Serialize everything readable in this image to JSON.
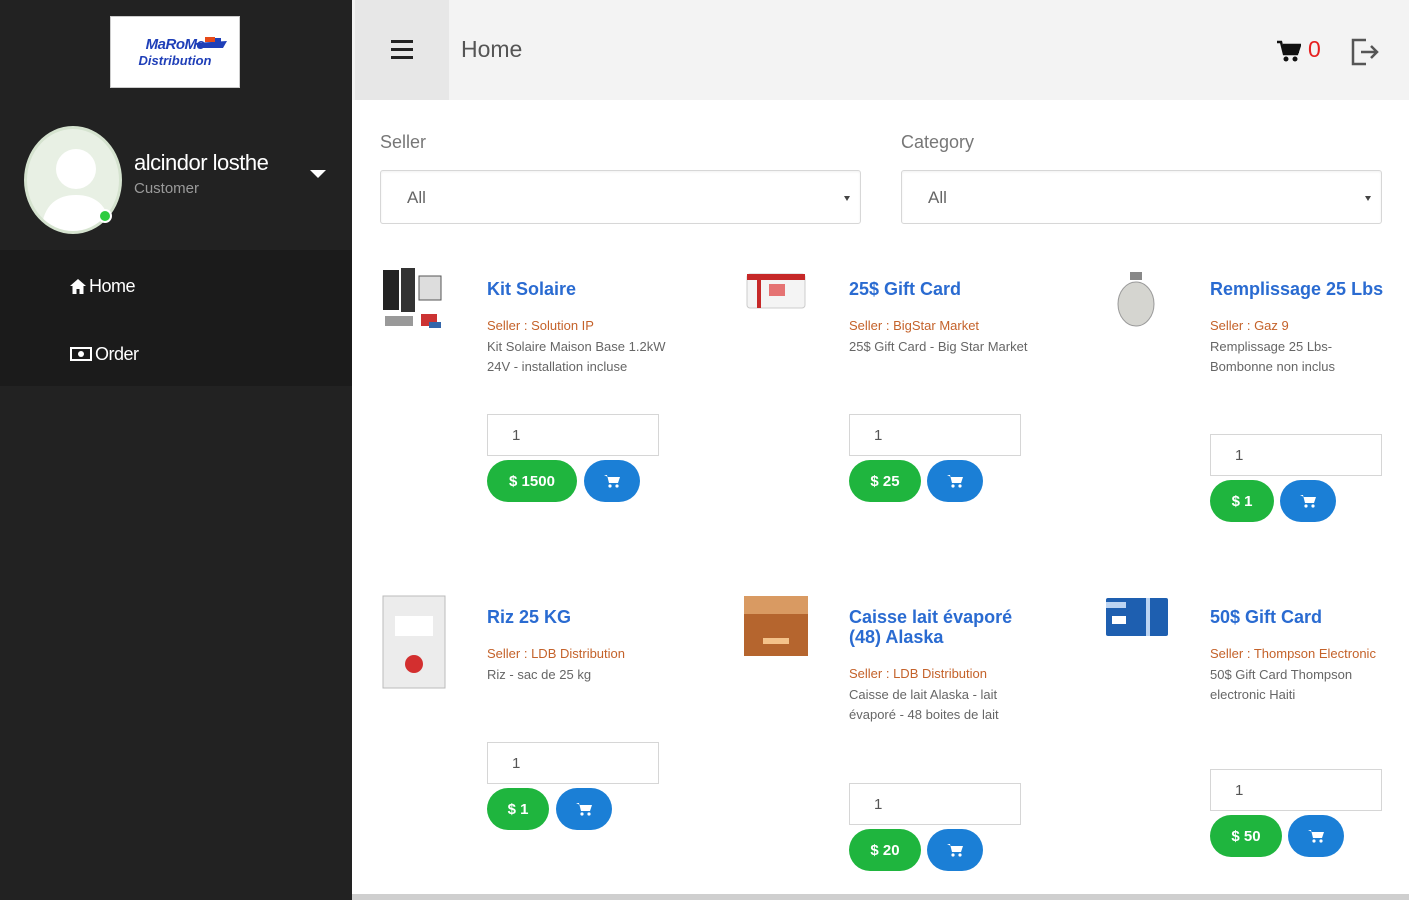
{
  "app": {
    "logo_line1": "MaRoMe",
    "logo_line2": "Distribution"
  },
  "profile": {
    "name": "alcindor losthe",
    "role": "Customer"
  },
  "sidebar": {
    "items": [
      {
        "label": "Home",
        "icon": "home-icon"
      },
      {
        "label": "Order",
        "icon": "money-icon"
      }
    ]
  },
  "header": {
    "title": "Home",
    "cart_count": "0"
  },
  "filters": {
    "seller_label": "Seller",
    "seller_value": "All",
    "category_label": "Category",
    "category_value": "All"
  },
  "products": [
    {
      "name": "Kit Solaire",
      "seller": "Seller : Solution IP",
      "desc": "Kit Solaire Maison Base 1.2kW 24V - installation incluse",
      "qty": "1",
      "price": "$ 1500"
    },
    {
      "name": "25$ Gift Card",
      "seller": "Seller : BigStar Market",
      "desc": "25$ Gift Card - Big Star Market",
      "qty": "1",
      "price": "$ 25"
    },
    {
      "name": "Remplissage 25 Lbs",
      "seller": "Seller : Gaz 9",
      "desc": "Remplissage 25 Lbs- Bombonne non inclus",
      "qty": "1",
      "price": "$ 1"
    },
    {
      "name": "Riz 25 KG",
      "seller": "Seller : LDB Distribution",
      "desc": "Riz - sac de 25 kg",
      "qty": "1",
      "price": "$ 1"
    },
    {
      "name": "Caisse lait évaporé (48) Alaska",
      "seller": "Seller : LDB Distribution",
      "desc": "Caisse de lait Alaska - lait évaporé - 48 boites de lait",
      "qty": "1",
      "price": "$ 20"
    },
    {
      "name": "50$ Gift Card",
      "seller": "Seller : Thompson Electronic",
      "desc": "50$ Gift Card Thompson electronic Haiti",
      "qty": "1",
      "price": "$ 50"
    }
  ],
  "colors": {
    "sidebar_bg": "#222222",
    "link": "#2a6bd1",
    "seller": "#c4622a",
    "price_button": "#1fb53e",
    "cart_button": "#1b7fd6",
    "cart_count": "#e62020"
  }
}
